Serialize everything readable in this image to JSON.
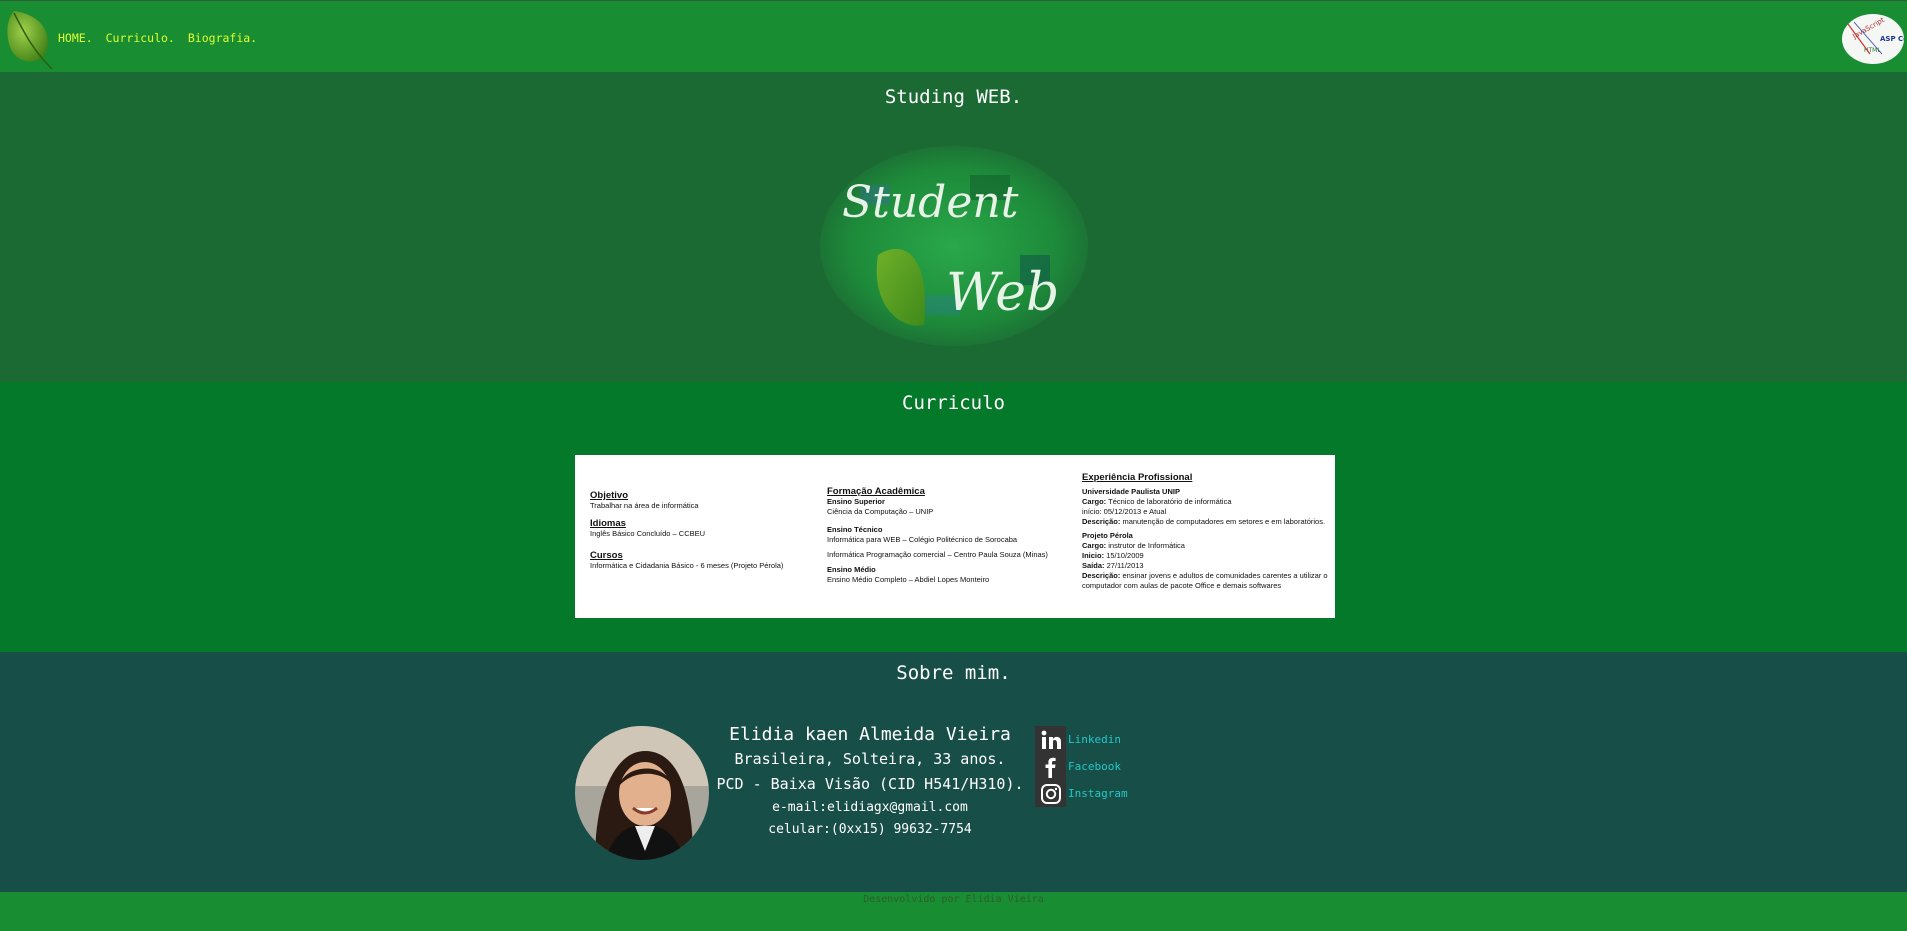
{
  "header": {
    "nav": [
      {
        "label": "HOME."
      },
      {
        "label": "Curriculo."
      },
      {
        "label": "Biografia."
      }
    ],
    "badge": {
      "text_top": "JavaScript",
      "text_mid": "ASP Co",
      "text_bottom": "HTML"
    }
  },
  "studing": {
    "title": "Studing WEB.",
    "logo": {
      "word1": "Student",
      "word2": "Web"
    }
  },
  "curriculo": {
    "title": "Curriculo",
    "col1": {
      "objetivo_h": "Objetivo",
      "objetivo": "Trabalhar na área de informática",
      "idiomas_h": "Idiomas",
      "idiomas": "Inglês Básico Concluído – CCBEU",
      "cursos_h": "Cursos",
      "cursos": "Informática e Cidadania Básico - 6 meses (Projeto Pérola)"
    },
    "col2": {
      "h": "Formação Acadêmica",
      "sup_h": "Ensino Superior",
      "sup": "Ciência da Computação – UNIP",
      "tec_h": "Ensino Técnico",
      "tec1": "Informática para WEB – Colégio Politécnico de Sorocaba",
      "tec2": "Informática Programação comercial – Centro Paula Souza (Minas)",
      "med_h": "Ensino Médio",
      "med": "Ensino Médio Completo – Abdiel Lopes Monteiro"
    },
    "col3": {
      "h": "Experiência Profissional",
      "e1_h": "Universidade Paulista UNIP",
      "e1_cargo_l": "Cargo:",
      "e1_cargo": "Técnico de laboratório de informática",
      "e1_inicio": "início: 05/12/2013 e Atual",
      "e1_desc_l": "Descrição:",
      "e1_desc": "manutenção de computadores em setores e em laboratórios.",
      "e2_h": "Projeto Pérola",
      "e2_cargo_l": "Cargo:",
      "e2_cargo": "instrutor de Informática",
      "e2_inicio_l": "Inicio:",
      "e2_inicio": "15/10/2009",
      "e2_saida_l": "Saída:",
      "e2_saida": "27/11/2013",
      "e2_desc_l": "Descrição:",
      "e2_desc": "ensinar jovens e adultos de comunidades carentes a utilizar o computador com aulas de pacote Office e demais softwares"
    }
  },
  "sobre": {
    "title": "Sobre mim.",
    "name": "Elidia kaen Almeida Vieira",
    "line1": "Brasileira, Solteira, 33 anos.",
    "line2": "PCD - Baixa Visão (CID H541/H310).",
    "email": "e-mail:elidiagx@gmail.com",
    "phone": "celular:(0xx15) 99632-7754",
    "social": [
      {
        "label": "Linkedin",
        "icon": "linkedin-icon"
      },
      {
        "label": "Facebook",
        "icon": "facebook-icon"
      },
      {
        "label": "Instagram",
        "icon": "instagram-icon"
      }
    ]
  },
  "footer": {
    "text": "Desenvolvido por Elidia Vieira"
  },
  "colors": {
    "header": "#188d31",
    "section1": "#1c6a33",
    "section2": "#04792a",
    "section3": "#184e48",
    "nav_text": "#dfff35",
    "social_link": "#22c7c7"
  }
}
